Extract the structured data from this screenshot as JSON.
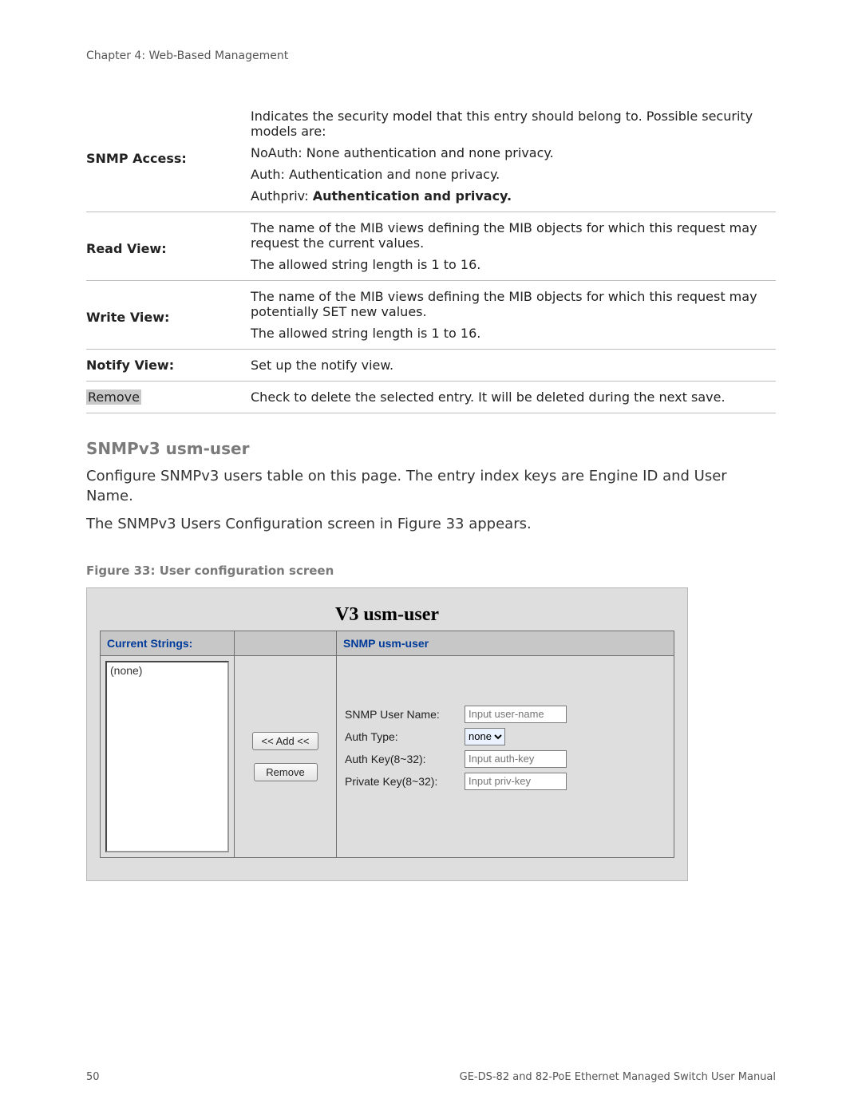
{
  "header": {
    "running": "Chapter 4: Web-Based Management"
  },
  "param_table": {
    "row1": {
      "label": "SNMP Access:",
      "p1": "Indicates the security model that this entry should belong to. Possible security models are:",
      "p2": "NoAuth: None authentication and none privacy.",
      "p3": "Auth: Authentication and none privacy.",
      "p4a": "Authpriv: ",
      "p4b": "Authentication and privacy."
    },
    "row2": {
      "label": "Read View:",
      "p1": "The name of the MIB views defining the MIB objects for which this request may request the current values.",
      "p2": "The allowed string length is 1 to 16."
    },
    "row3": {
      "label": "Write View:",
      "p1": "The name of the MIB views defining the MIB objects for which this request may potentially SET new values.",
      "p2": "The allowed string length is 1 to 16."
    },
    "row4": {
      "label": "Notify View:",
      "p1": "Set up the notify view."
    },
    "row5": {
      "label": "Remove",
      "p1": "Check to delete the selected entry. It will be deleted during the next save."
    }
  },
  "section": {
    "heading": "SNMPv3 usm-user",
    "para1": "Configure SNMPv3 users table on this page. The entry index keys are Engine ID and User Name.",
    "para2": "The SNMPv3 Users Configuration screen in Figure 33 appears.",
    "figcap": "Figure 33: User configuration screen"
  },
  "figure": {
    "title": "V3 usm-user",
    "col1_header": "Current Strings:",
    "col3_header": "SNMP usm-user",
    "list_item": "(none)",
    "btn_add": "<< Add <<",
    "btn_remove": "Remove",
    "form": {
      "l1": "SNMP User Name:",
      "ph1": "Input user-name",
      "l2": "Auth Type:",
      "opt2": "none",
      "l3": "Auth Key(8~32):",
      "ph3": "Input auth-key",
      "l4": "Private Key(8~32):",
      "ph4": "Input priv-key"
    }
  },
  "footer": {
    "page": "50",
    "manual": "GE-DS-82 and 82-PoE Ethernet Managed Switch User Manual"
  }
}
